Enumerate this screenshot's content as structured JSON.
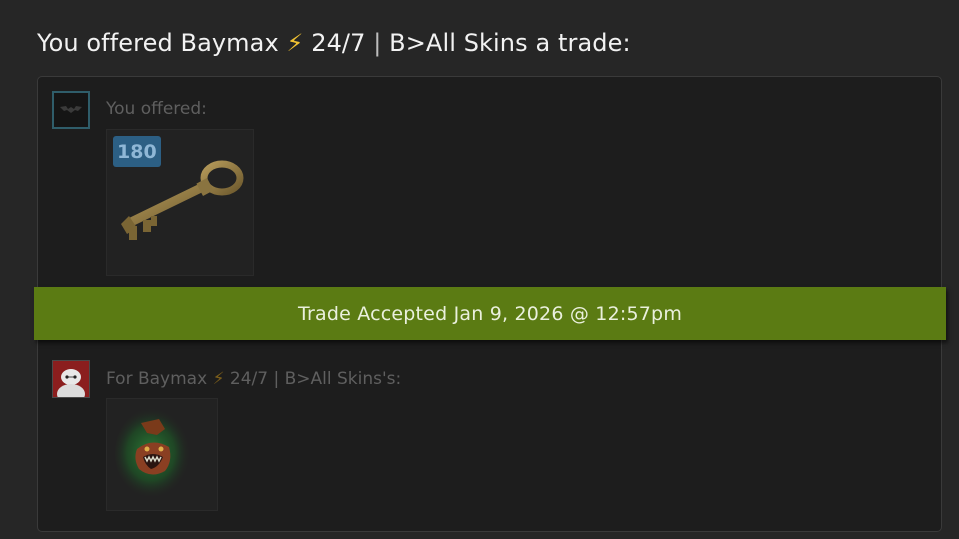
{
  "heading": {
    "prefix": "You offered Baymax ",
    "bolt": "⚡",
    "mid": " 24/7 ",
    "sep": "|",
    "suffix": " B>All Skins a trade:"
  },
  "offer": {
    "label": "You offered:",
    "item": {
      "name": "key-icon",
      "count": "180"
    }
  },
  "status": {
    "text": "Trade Accepted Jan 9, 2026 @ 12:57pm",
    "color": "#5b7b13"
  },
  "receive": {
    "prefix": "For Baymax ",
    "bolt": "⚡",
    "mid": " 24/7 ",
    "sep": "|",
    "suffix": " B>All Skins's:",
    "item": {
      "name": "cosmetic-item-icon"
    }
  }
}
